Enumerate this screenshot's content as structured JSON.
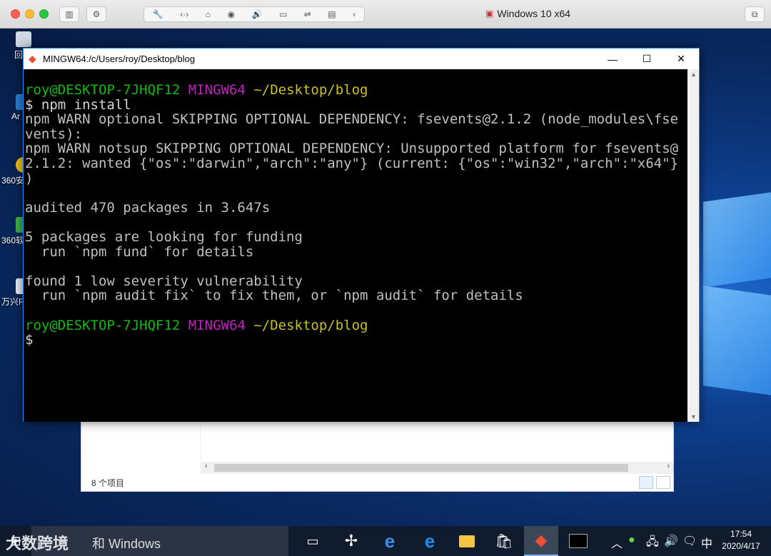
{
  "mac": {
    "vm_title": "Windows 10 x64"
  },
  "desktop_icons": [
    "回",
    "Ar",
    "360安",
    "360软",
    "万兴F"
  ],
  "terminal": {
    "title": "MINGW64:/c/Users/roy/Desktop/blog",
    "prompt_user": "roy@DESKTOP-7JHQF12",
    "prompt_shell": "MINGW64",
    "prompt_path": "~/Desktop/blog",
    "command": "$ npm install",
    "warn1a": "npm WARN optional SKIPPING OPTIONAL DEPENDENCY: fsevents@2.1.2 (node_modules\\fse",
    "warn1b": "vents):",
    "warn2a": "npm WARN notsup SKIPPING OPTIONAL DEPENDENCY: Unsupported platform for fsevents@",
    "warn2b": "2.1.2: wanted {\"os\":\"darwin\",\"arch\":\"any\"} (current: {\"os\":\"win32\",\"arch\":\"x64\"}",
    "warn2c": ")",
    "audited": "audited 470 packages in 3.647s",
    "funding1": "5 packages are looking for funding",
    "funding2": "  run `npm fund` for details",
    "vuln1": "found 1 low severity vulnerability",
    "vuln2": "  run `npm audit fix` to fix them, or `npm audit` for details",
    "prompt_end": "$"
  },
  "explorer": {
    "status": "8 个项目"
  },
  "taskbar": {
    "search_placeholder": "和 Windows",
    "ime": "中",
    "time": "17:54",
    "date": "2020/4/17"
  },
  "watermark": "大数跨境",
  "colors": {
    "term_bg": "#000000",
    "green": "#0dbc0d",
    "magenta": "#c51cc5",
    "yellow": "#c9c21a",
    "accent": "#1e90ff"
  }
}
